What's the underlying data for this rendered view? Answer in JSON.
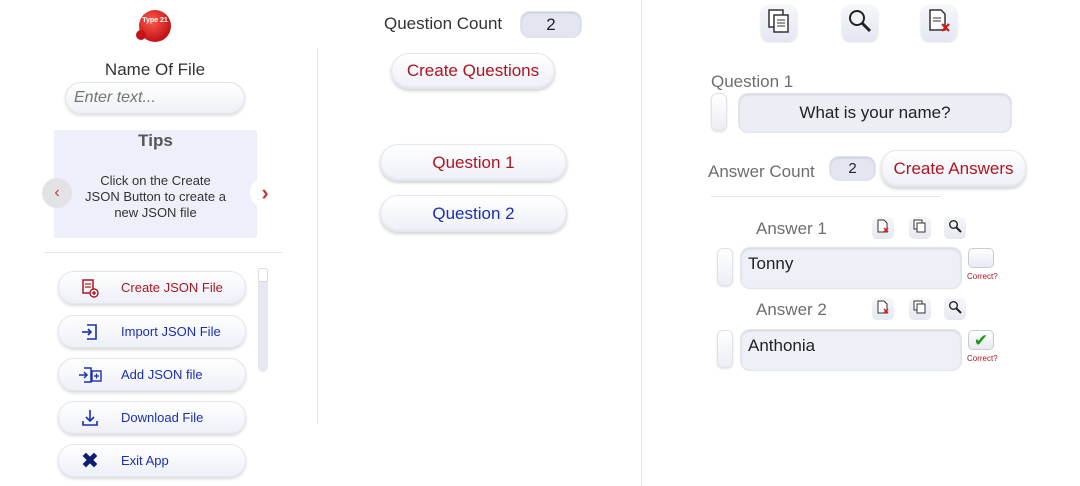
{
  "sidebar": {
    "logo_text": "Type 21",
    "file_name_label": "Name Of File",
    "file_name_placeholder": "Enter text...",
    "tips_title": "Tips",
    "tips_text": "Click on the Create JSON Button to create a new JSON file",
    "menu": [
      {
        "label": "Create JSON File",
        "icon": "create-file-icon"
      },
      {
        "label": "Import JSON File",
        "icon": "import-icon"
      },
      {
        "label": "Add JSON file",
        "icon": "add-file-icon"
      },
      {
        "label": "Download File",
        "icon": "download-icon"
      },
      {
        "label": "Exit App",
        "icon": "close-icon"
      }
    ]
  },
  "questions_panel": {
    "count_label": "Question Count",
    "count_value": "2",
    "create_button": "Create Questions",
    "items": [
      "Question 1",
      "Question 2"
    ]
  },
  "editor": {
    "question_label": "Question 1",
    "question_text": "What is your name?",
    "answer_count_label": "Answer Count",
    "answer_count_value": "2",
    "create_answers_button": "Create Answers",
    "answers": [
      {
        "label": "Answer 1",
        "text": "Tonny",
        "correct_label": "Correct?",
        "correct": false
      },
      {
        "label": "Answer 2",
        "text": "Anthonia",
        "correct_label": "Correct?",
        "correct": true
      }
    ]
  },
  "colors": {
    "accent_red": "#b0141e",
    "accent_blue": "#1a2fb0",
    "check_green": "#1a9a1a"
  }
}
